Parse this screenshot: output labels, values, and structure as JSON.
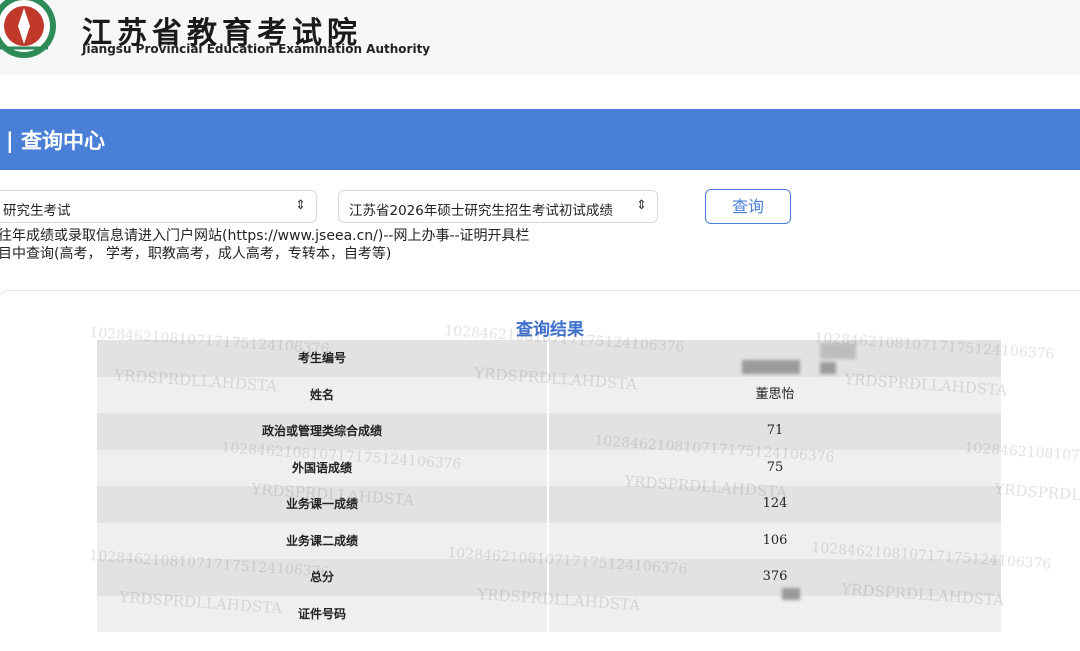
{
  "header": {
    "title_cn": "江苏省教育考试院",
    "title_en": "Jiangsu Provincial Education Examination Authority"
  },
  "section_bar": {
    "title": "| 查询中心"
  },
  "filters": {
    "exam_type": "研究生考试",
    "exam_name": "江苏省2026年硕士研究生招生考试初试成绩",
    "query_button": "查询"
  },
  "notes": [
    "往年成绩或录取信息请进入门户网站(https://www.jseea.cn/)--网上办事--证明开具栏",
    "目中查询(高考， 学考，职教高考，成人高考，专转本，自考等)"
  ],
  "result": {
    "title": "查询结果",
    "rows": [
      {
        "label": "考生编号",
        "value": ""
      },
      {
        "label": "姓名",
        "value": "董思怡"
      },
      {
        "label": "政治或管理类综合成绩",
        "value": "71"
      },
      {
        "label": "外国语成绩",
        "value": "75"
      },
      {
        "label": "业务课一成绩",
        "value": "124"
      },
      {
        "label": "业务课二成绩",
        "value": "106"
      },
      {
        "label": "总分",
        "value": "376"
      },
      {
        "label": "证件号码",
        "value": ""
      }
    ]
  },
  "watermark": {
    "number": "102846210810717175124106376",
    "code": "YRDSPRDLLAHDSTA"
  }
}
